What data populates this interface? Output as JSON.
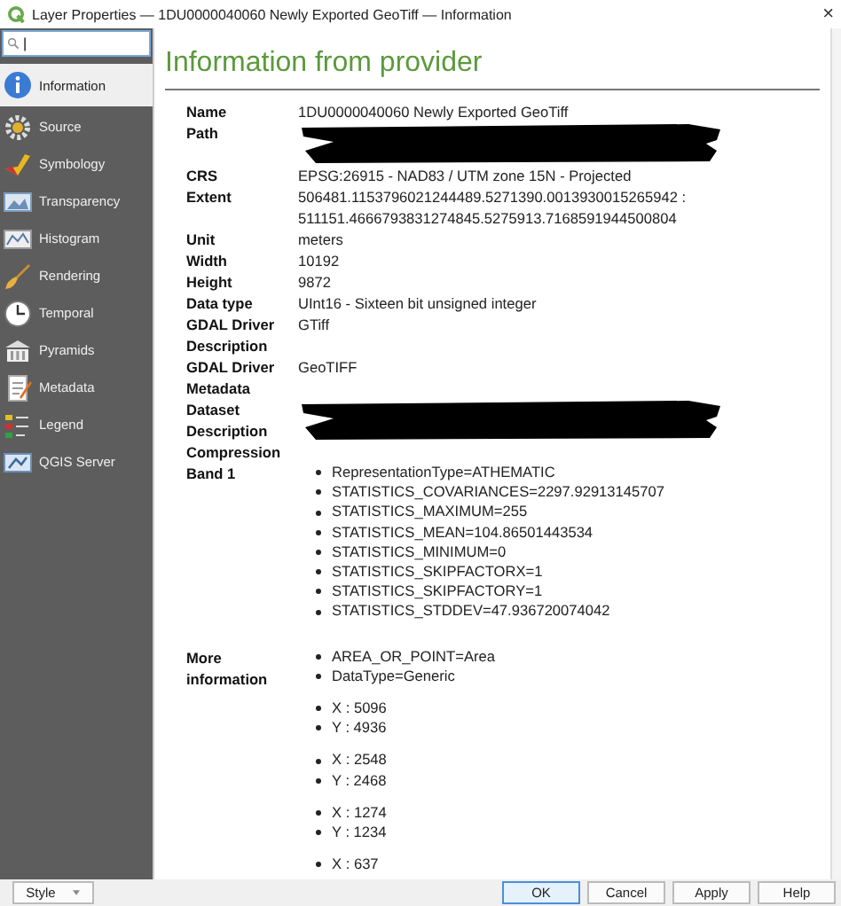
{
  "window": {
    "title": "Layer Properties — 1DU0000040060 Newly Exported GeoTiff — Information",
    "close": "×"
  },
  "sidebar": {
    "search": {
      "value": "|"
    },
    "items": [
      {
        "label": "Information",
        "selected": true
      },
      {
        "label": "Source",
        "selected": false
      },
      {
        "label": "Symbology",
        "selected": false
      },
      {
        "label": "Transparency",
        "selected": false
      },
      {
        "label": "Histogram",
        "selected": false
      },
      {
        "label": "Rendering",
        "selected": false
      },
      {
        "label": "Temporal",
        "selected": false
      },
      {
        "label": "Pyramids",
        "selected": false
      },
      {
        "label": "Metadata",
        "selected": false
      },
      {
        "label": "Legend",
        "selected": false
      },
      {
        "label": "QGIS Server",
        "selected": false
      }
    ]
  },
  "content": {
    "heading": "Information from provider",
    "rows": [
      {
        "kind": "text",
        "label": "Name",
        "lines": [
          "1DU0000040060 Newly Exported GeoTiff"
        ]
      },
      {
        "kind": "redacted",
        "label": "Path"
      },
      {
        "kind": "text",
        "label": "CRS",
        "lines": [
          "EPSG:26915 - NAD83 / UTM zone 15N - Projected"
        ]
      },
      {
        "kind": "text",
        "label": "Extent",
        "lines": [
          "506481.1153796021244489.5271390.0013930015265942 :",
          "511151.4666793831274845.5275913.7168591944500804"
        ]
      },
      {
        "kind": "text",
        "label": "Unit",
        "lines": [
          "meters"
        ]
      },
      {
        "kind": "text",
        "label": "Width",
        "lines": [
          "10192"
        ]
      },
      {
        "kind": "text",
        "label": "Height",
        "lines": [
          "9872"
        ]
      },
      {
        "kind": "text",
        "label": "Data type",
        "lines": [
          "UInt16 - Sixteen bit unsigned integer"
        ]
      },
      {
        "kind": "text",
        "label": "GDAL Driver Description",
        "lines": [
          "GTiff"
        ]
      },
      {
        "kind": "text",
        "label": "GDAL Driver Metadata",
        "lines": [
          "GeoTIFF"
        ]
      },
      {
        "kind": "redacted",
        "label": "Dataset Description"
      },
      {
        "kind": "text",
        "label": "Compression",
        "lines": []
      },
      {
        "kind": "list",
        "label": "Band 1",
        "groups": [
          [
            "RepresentationType=ATHEMATIC",
            "STATISTICS_COVARIANCES=2297.92913145707",
            "STATISTICS_MAXIMUM=255",
            "STATISTICS_MEAN=104.86501443534",
            "STATISTICS_MINIMUM=0",
            "STATISTICS_SKIPFACTORX=1",
            "STATISTICS_SKIPFACTORY=1",
            "STATISTICS_STDDEV=47.936720074042"
          ]
        ]
      },
      {
        "kind": "list",
        "label": "More information",
        "groups": [
          [
            "AREA_OR_POINT=Area",
            "DataType=Generic"
          ],
          [
            "X : 5096",
            "Y : 4936"
          ],
          [
            "X : 2548",
            "Y : 2468"
          ],
          [
            "X : 1274",
            "Y : 1234"
          ],
          [
            "X : 637"
          ]
        ]
      }
    ]
  },
  "footer": {
    "style": "Style",
    "buttons": [
      {
        "label": "OK",
        "default": true
      },
      {
        "label": "Cancel",
        "default": false
      },
      {
        "label": "Apply",
        "default": false
      },
      {
        "label": "Help",
        "default": false
      }
    ]
  }
}
